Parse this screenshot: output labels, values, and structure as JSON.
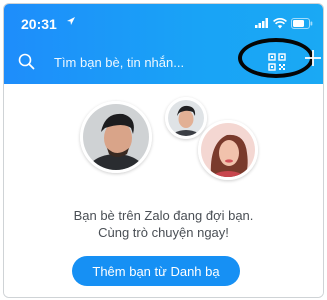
{
  "status_bar": {
    "time": "20:31"
  },
  "header": {
    "search_placeholder": "Tìm bạn bè, tin nhắn...",
    "qr_icon": "qr-code-icon",
    "add_icon": "plus-icon"
  },
  "empty_state": {
    "message_line1": "Bạn bè trên Zalo đang đợi bạn.",
    "message_line2": "Cùng trò chuyện ngay!",
    "button_label": "Thêm bạn từ Danh bạ"
  },
  "colors": {
    "header_gradient_start": "#1e8dfb",
    "header_gradient_end": "#1aa9f4",
    "button_blue": "#1690f4",
    "highlight_ring": "#050505"
  }
}
